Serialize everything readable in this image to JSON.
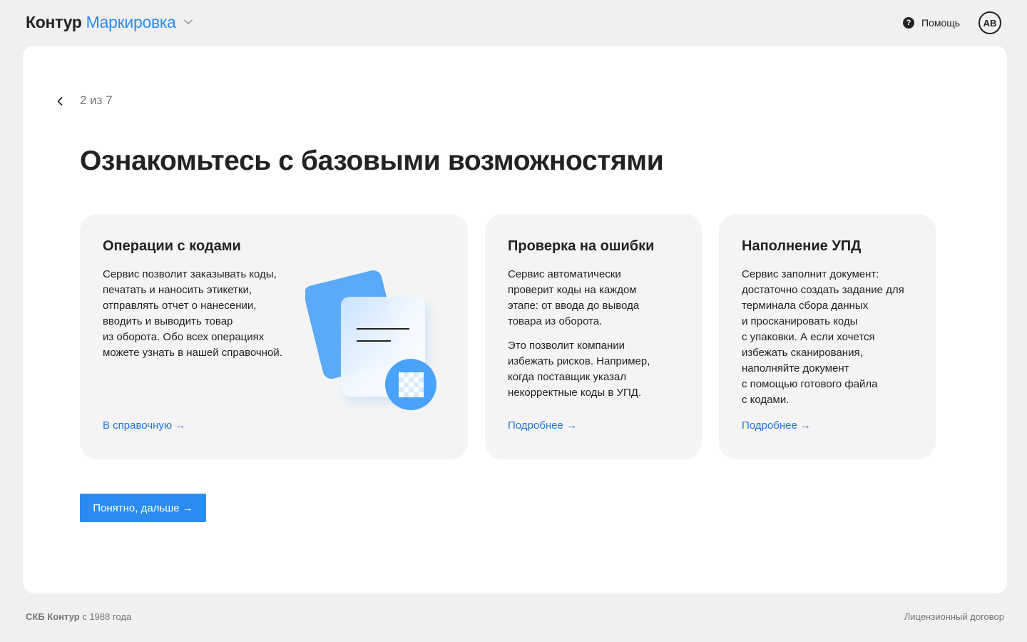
{
  "header": {
    "brand": "Контур",
    "product": "Маркировка",
    "help_label": "Помощь",
    "avatar_initials": "АВ"
  },
  "wizard": {
    "step": "2 из 7",
    "title": "Ознакомьтесь с базовыми возможностями",
    "next_button": "Понятно, дальше →"
  },
  "cards": [
    {
      "title": "Операции с кодами",
      "lines": [
        "Сервис позволит заказывать коды,",
        "печатать и наносить этикетки,",
        "отправлять отчет о нанесении,",
        "вводить и выводить товар",
        "из оборота. Обо всех операциях",
        "можете узнать в нашей справочной."
      ],
      "link": "В справочную →"
    },
    {
      "title": "Проверка на ошибки",
      "lines": [
        "Сервис автоматически",
        "проверит коды на каждом",
        "этапе: от ввода до вывода",
        "товара из оборота."
      ],
      "lines2": [
        "Это позволит компании",
        "избежать рисков. Например,",
        "когда поставщик указал",
        "некорректные коды в УПД."
      ],
      "link": "Подробнее →"
    },
    {
      "title": "Наполнение УПД",
      "lines": [
        "Сервис заполнит документ:",
        "достаточно создать задание для",
        "терминала сбора данных",
        "и просканировать коды",
        "с упаковки. А если хочется",
        "избежать сканирования,",
        "наполняйте документ",
        "с помощью готового файла",
        "с кодами."
      ],
      "link": "Подробнее →"
    }
  ],
  "footer": {
    "company": "СКБ Контур",
    "since": " с 1988 года",
    "license": "Лицензионный договор"
  },
  "colors": {
    "accent": "#2a8cf1",
    "link": "#1f76d6",
    "page_bg": "#f0f0f0",
    "card_bg": "#f4f4f4"
  }
}
